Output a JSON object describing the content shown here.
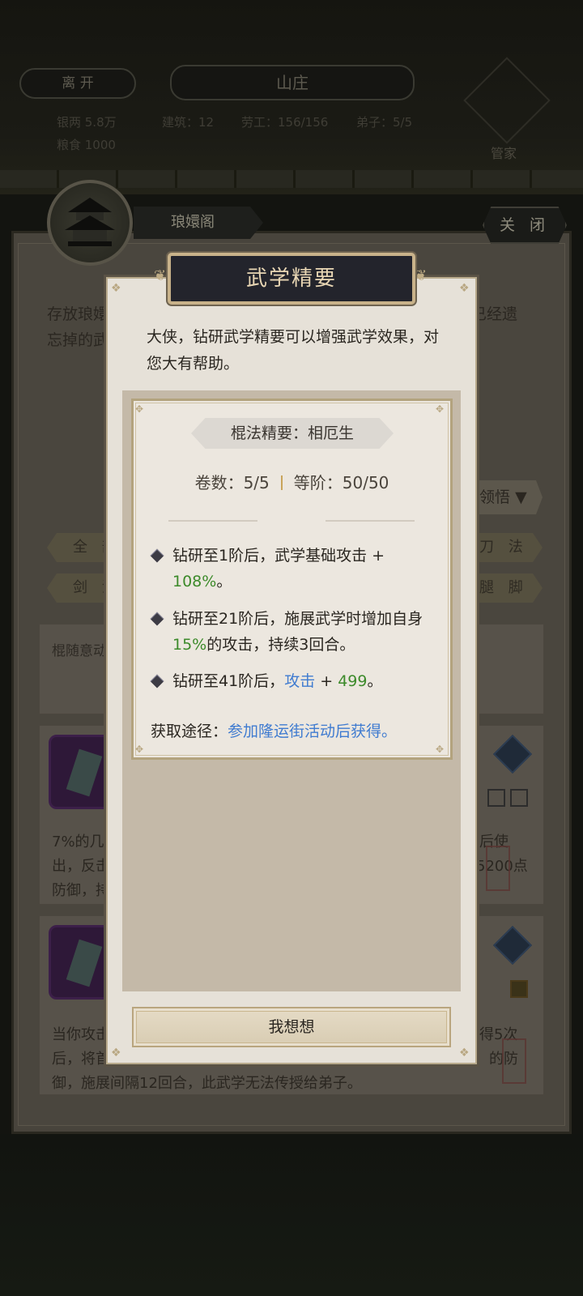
{
  "top_bar": {
    "leave_label": "离 开",
    "villa_title": "山庄",
    "stats": {
      "building": "建筑：12",
      "workers": "劳工：156/156",
      "disciples": "弟子：5/5"
    },
    "steward_label": "管家",
    "left_info": [
      "银两 5.8万",
      "粮食 1000"
    ]
  },
  "pavilion_panel": {
    "title": "琅嬛阁",
    "close_label": "关 闭",
    "description_line1_left": "存放琅嬛",
    "description_line1_right": "已经遗",
    "description_line2_left": "忘掉的武",
    "dropdown_label": "领悟",
    "tabs_left": [
      "全 部",
      "剑 法"
    ],
    "tabs_right": [
      "刀 法",
      "腿 脚"
    ],
    "first_card_text": "棍随意动",
    "card1_text": {
      "line1_left": "7%的几",
      "line1_right": "后使",
      "line2_left": "出，反击",
      "line2_right": "5200点",
      "line3_left": "防御，持"
    },
    "card2_text": {
      "line1_left": "当你攻击",
      "line1_right": "得5次",
      "line2_left": "后，将首",
      "line2_right": "的防",
      "line3": "御，施展间隔12回合，此武学无法传授给弟子。"
    }
  },
  "modal": {
    "title": "武学精要",
    "intro": "大侠，钻研武学精要可以增强武学效果，对您大有帮助。",
    "essence_name": "棍法精要：相厄生",
    "volumes_label": "卷数：5/5",
    "rank_label": "等阶：50/50",
    "effects": [
      {
        "text": "钻研至1阶后，武学基础攻击 +",
        "value": "108%",
        "tail": "。"
      },
      {
        "text": "钻研至21阶后，施展武学时增加自身",
        "value": "15%",
        "tail": "的攻击，持续3回合。"
      },
      {
        "text": "钻研至41阶后，",
        "stat": "攻击",
        "plus": " + ",
        "value": "499",
        "tail": "。"
      }
    ],
    "source_label": "获取途径：",
    "source_text": "参加隆运街活动后获得。",
    "button_label": "我想想"
  },
  "colors": {
    "modal_bg": "#e6e1d8",
    "header_bg": "#23242c",
    "header_text": "#e8d6b4",
    "gold_border": "#b9a57e",
    "value_green": "#3c8a2a",
    "link_blue": "#3f7bd0"
  }
}
